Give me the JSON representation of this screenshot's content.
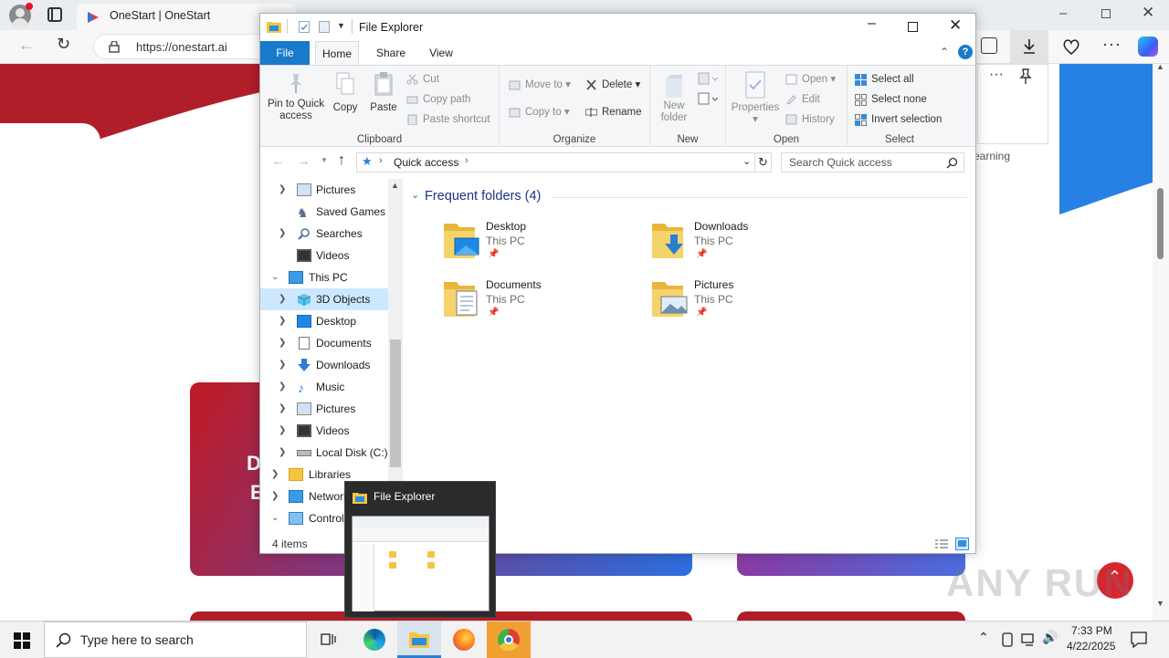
{
  "browser": {
    "tab_title": "OneStart | OneStart",
    "url": "https://onestart.ai",
    "side_text": "earning"
  },
  "explorer": {
    "title": "File Explorer",
    "ribbon_tabs": [
      "File",
      "Home",
      "Share",
      "View"
    ],
    "clipboard": {
      "pin": "Pin to Quick access",
      "pin_line1": "Pin to Quick",
      "pin_line2": "access",
      "copy": "Copy",
      "paste": "Paste",
      "cut": "Cut",
      "copy_path": "Copy path",
      "paste_shortcut": "Paste shortcut",
      "group": "Clipboard"
    },
    "organize": {
      "move_to": "Move to",
      "copy_to": "Copy to",
      "delete": "Delete",
      "rename": "Rename",
      "group": "Organize"
    },
    "new": {
      "new_folder_line1": "New",
      "new_folder_line2": "folder",
      "group": "New"
    },
    "open": {
      "properties": "Properties",
      "open": "Open",
      "edit": "Edit",
      "history": "History",
      "group": "Open"
    },
    "select": {
      "select_all": "Select all",
      "select_none": "Select none",
      "invert": "Invert selection",
      "group": "Select"
    },
    "address": "Quick access",
    "search_placeholder": "Search Quick access",
    "section_header": "Frequent folders (4)",
    "folders": [
      {
        "name": "Desktop",
        "location": "This PC"
      },
      {
        "name": "Downloads",
        "location": "This PC"
      },
      {
        "name": "Documents",
        "location": "This PC"
      },
      {
        "name": "Pictures",
        "location": "This PC"
      }
    ],
    "tree": [
      {
        "label": "Pictures"
      },
      {
        "label": "Saved Games"
      },
      {
        "label": "Searches"
      },
      {
        "label": "Videos"
      },
      {
        "label": "This PC"
      },
      {
        "label": "3D Objects"
      },
      {
        "label": "Desktop"
      },
      {
        "label": "Documents"
      },
      {
        "label": "Downloads"
      },
      {
        "label": "Music"
      },
      {
        "label": "Pictures"
      },
      {
        "label": "Videos"
      },
      {
        "label": "Local Disk (C:)"
      },
      {
        "label": "Libraries"
      },
      {
        "label": "Network"
      },
      {
        "label": "Control Panel"
      }
    ],
    "status": "4 items"
  },
  "thumbnail": {
    "title": "File Explorer"
  },
  "taskbar": {
    "search_placeholder": "Type here to search",
    "time": "7:33 PM",
    "date": "4/22/2025"
  },
  "watermark": "ANY RUN",
  "colors": {
    "accent": "#0078d4",
    "brand_red": "#c8102e",
    "brand_blue": "#1f7fe0",
    "folder_yellow": "#f5c542"
  }
}
